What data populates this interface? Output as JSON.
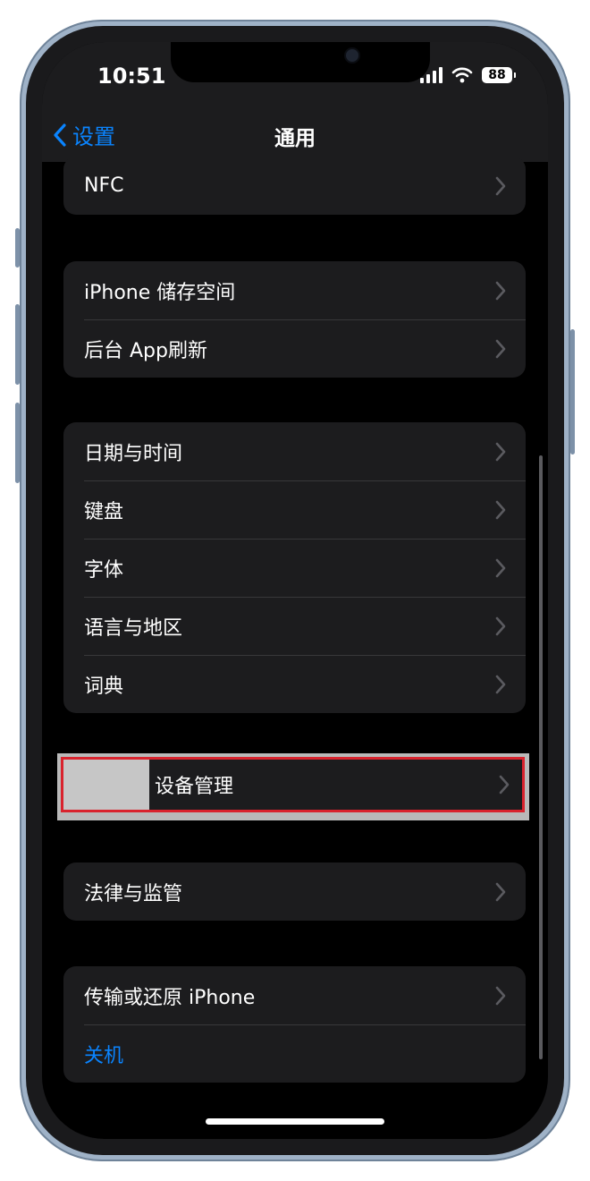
{
  "status": {
    "time": "10:51",
    "battery": "88"
  },
  "nav": {
    "back_label": "设置",
    "title": "通用"
  },
  "groups": {
    "nfc": {
      "items": [
        {
          "label": "NFC"
        }
      ]
    },
    "storage": {
      "items": [
        {
          "label": "iPhone 储存空间"
        },
        {
          "label": "后台 App刷新"
        }
      ]
    },
    "locale": {
      "items": [
        {
          "label": "日期与时间"
        },
        {
          "label": "键盘"
        },
        {
          "label": "字体"
        },
        {
          "label": "语言与地区"
        },
        {
          "label": "词典"
        }
      ]
    },
    "device": {
      "items": [
        {
          "label": "设备管理"
        }
      ]
    },
    "legal": {
      "items": [
        {
          "label": "法律与监管"
        }
      ]
    },
    "reset": {
      "items": [
        {
          "label": "传输或还原 iPhone"
        },
        {
          "label": "关机"
        }
      ]
    }
  },
  "colors": {
    "accent": "#0a84ff",
    "highlight_border": "#d9232d",
    "background": "#000000",
    "cell": "#1c1c1e"
  }
}
